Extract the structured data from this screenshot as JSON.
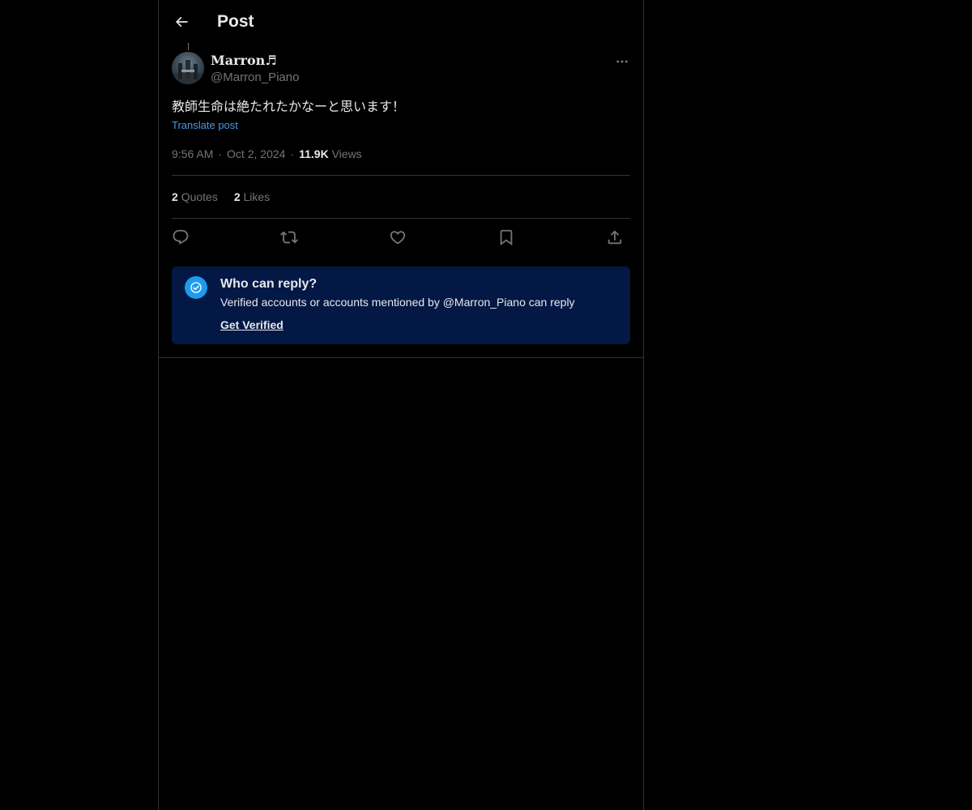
{
  "header": {
    "back_icon": "arrow-left-icon",
    "title": "Post"
  },
  "post": {
    "author": {
      "display_name": "Marron♬",
      "handle": "@Marron_Piano"
    },
    "more_icon": "more-horizontal-icon",
    "text": "教師生命は絶たれたかなーと思います！",
    "translate_label": "Translate post",
    "time": "9:56 AM",
    "date": "Oct 2, 2024",
    "views_count": "11.9K",
    "views_label": "Views",
    "separator": "·"
  },
  "stats": {
    "quotes_count": "2",
    "quotes_label": "Quotes",
    "likes_count": "2",
    "likes_label": "Likes"
  },
  "actions": [
    {
      "name": "reply",
      "icon": "reply-icon"
    },
    {
      "name": "repost",
      "icon": "repost-icon"
    },
    {
      "name": "like",
      "icon": "heart-icon"
    },
    {
      "name": "bookmark",
      "icon": "bookmark-icon"
    },
    {
      "name": "share",
      "icon": "share-icon"
    }
  ],
  "reply_restriction": {
    "title": "Who can reply?",
    "description": "Verified accounts or accounts mentioned by @Marron_Piano can reply",
    "cta": "Get Verified",
    "badge_icon": "verified-badge-icon"
  },
  "colors": {
    "background": "#000000",
    "text": "#e7e9ea",
    "muted": "#71767b",
    "link": "#4a99e9",
    "border": "#2f3336",
    "reply_box_bg": "#031845",
    "accent": "#1d9bf0"
  }
}
